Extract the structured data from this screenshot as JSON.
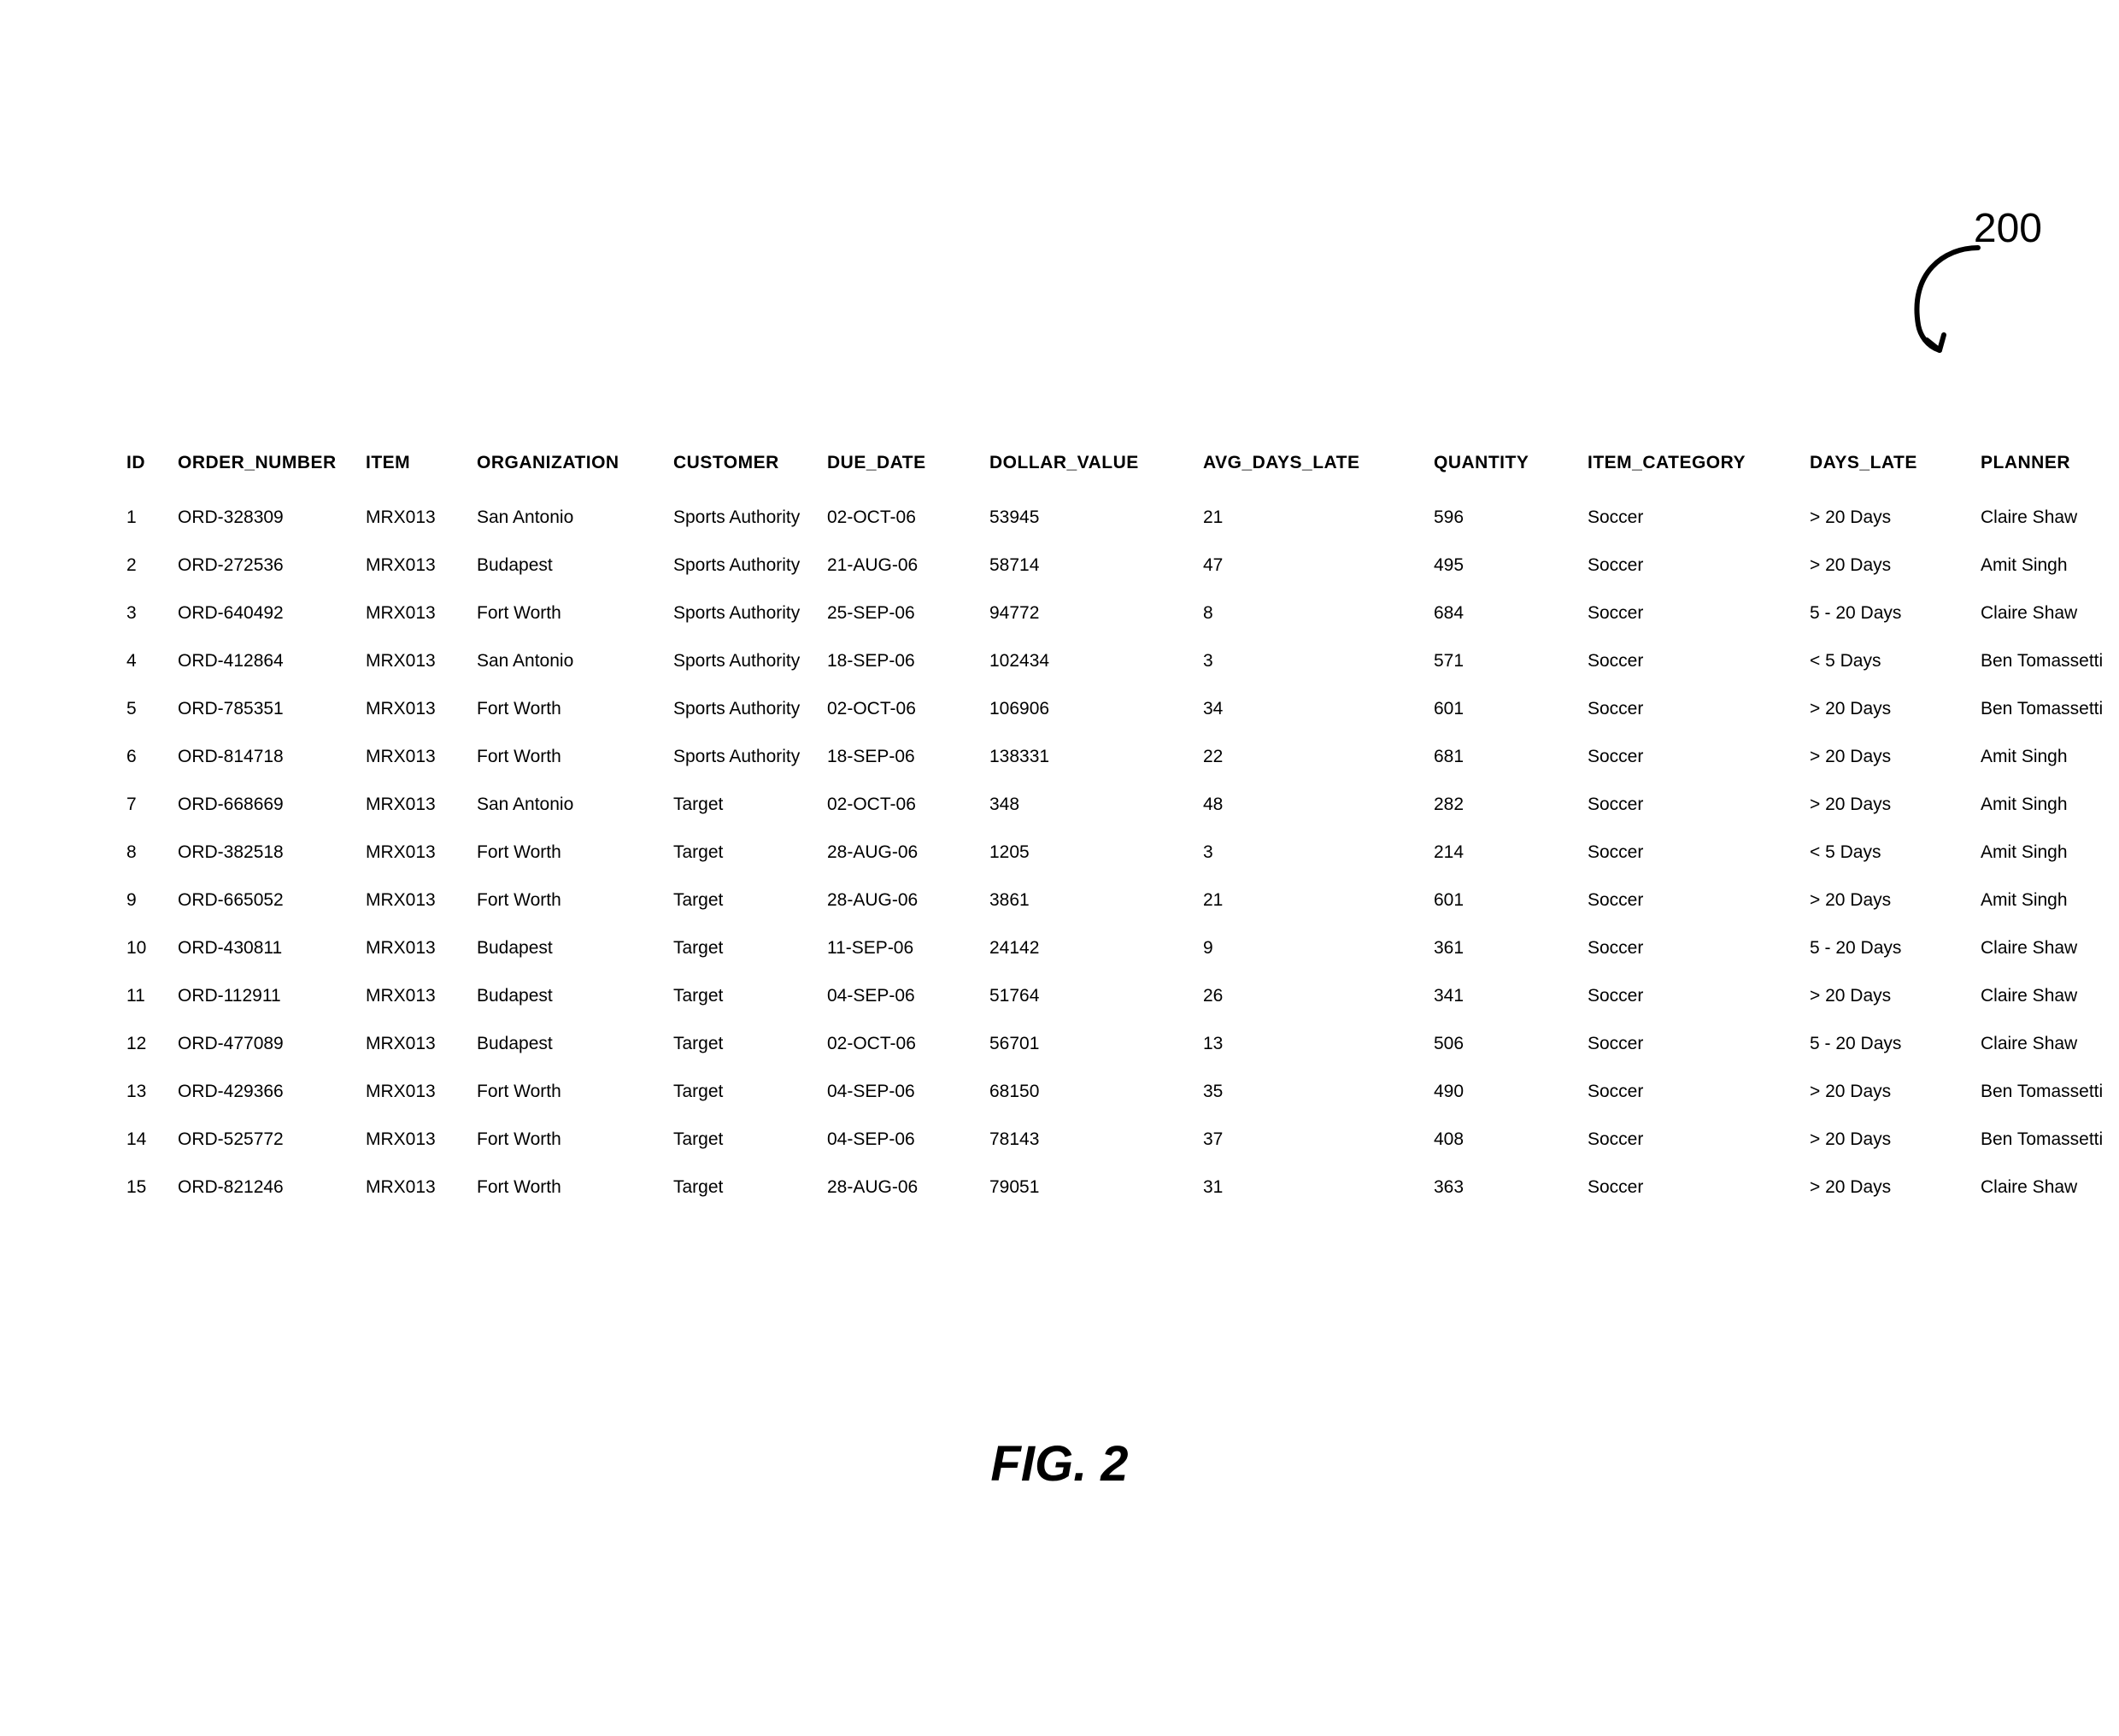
{
  "callout": {
    "number": "200"
  },
  "caption": "FIG. 2",
  "table": {
    "headers": {
      "id": "ID",
      "order_number": "ORDER_NUMBER",
      "item": "ITEM",
      "organization": "ORGANIZATION",
      "customer": "CUSTOMER",
      "due_date": "DUE_DATE",
      "dollar_value": "DOLLAR_VALUE",
      "avg_days_late": "AVG_DAYS_LATE",
      "quantity": "QUANTITY",
      "item_category": "ITEM_CATEGORY",
      "days_late": "DAYS_LATE",
      "planner": "PLANNER"
    },
    "rows": [
      {
        "id": "1",
        "order_number": "ORD-328309",
        "item": "MRX013",
        "organization": "San Antonio",
        "customer": "Sports Authority",
        "due_date": "02-OCT-06",
        "dollar_value": "53945",
        "avg_days_late": "21",
        "quantity": "596",
        "item_category": "Soccer",
        "days_late": "> 20 Days",
        "planner": "Claire Shaw"
      },
      {
        "id": "2",
        "order_number": "ORD-272536",
        "item": "MRX013",
        "organization": "Budapest",
        "customer": "Sports Authority",
        "due_date": "21-AUG-06",
        "dollar_value": "58714",
        "avg_days_late": "47",
        "quantity": "495",
        "item_category": "Soccer",
        "days_late": "> 20 Days",
        "planner": "Amit Singh"
      },
      {
        "id": "3",
        "order_number": "ORD-640492",
        "item": "MRX013",
        "organization": "Fort Worth",
        "customer": "Sports Authority",
        "due_date": "25-SEP-06",
        "dollar_value": "94772",
        "avg_days_late": "8",
        "quantity": "684",
        "item_category": "Soccer",
        "days_late": "5 - 20 Days",
        "planner": "Claire Shaw"
      },
      {
        "id": "4",
        "order_number": "ORD-412864",
        "item": "MRX013",
        "organization": "San Antonio",
        "customer": "Sports Authority",
        "due_date": "18-SEP-06",
        "dollar_value": "102434",
        "avg_days_late": "3",
        "quantity": "571",
        "item_category": "Soccer",
        "days_late": "< 5 Days",
        "planner": "Ben Tomassetti"
      },
      {
        "id": "5",
        "order_number": "ORD-785351",
        "item": "MRX013",
        "organization": "Fort Worth",
        "customer": "Sports Authority",
        "due_date": "02-OCT-06",
        "dollar_value": "106906",
        "avg_days_late": "34",
        "quantity": "601",
        "item_category": "Soccer",
        "days_late": "> 20 Days",
        "planner": "Ben Tomassetti"
      },
      {
        "id": "6",
        "order_number": "ORD-814718",
        "item": "MRX013",
        "organization": "Fort Worth",
        "customer": "Sports Authority",
        "due_date": "18-SEP-06",
        "dollar_value": "138331",
        "avg_days_late": "22",
        "quantity": "681",
        "item_category": "Soccer",
        "days_late": "> 20 Days",
        "planner": "Amit Singh"
      },
      {
        "id": "7",
        "order_number": "ORD-668669",
        "item": "MRX013",
        "organization": "San Antonio",
        "customer": "Target",
        "due_date": "02-OCT-06",
        "dollar_value": "348",
        "avg_days_late": "48",
        "quantity": "282",
        "item_category": "Soccer",
        "days_late": "> 20 Days",
        "planner": "Amit Singh"
      },
      {
        "id": "8",
        "order_number": "ORD-382518",
        "item": "MRX013",
        "organization": "Fort Worth",
        "customer": "Target",
        "due_date": "28-AUG-06",
        "dollar_value": "1205",
        "avg_days_late": "3",
        "quantity": "214",
        "item_category": "Soccer",
        "days_late": "< 5 Days",
        "planner": "Amit Singh"
      },
      {
        "id": "9",
        "order_number": "ORD-665052",
        "item": "MRX013",
        "organization": "Fort Worth",
        "customer": "Target",
        "due_date": "28-AUG-06",
        "dollar_value": "3861",
        "avg_days_late": "21",
        "quantity": "601",
        "item_category": "Soccer",
        "days_late": "> 20 Days",
        "planner": "Amit Singh"
      },
      {
        "id": "10",
        "order_number": "ORD-430811",
        "item": "MRX013",
        "organization": "Budapest",
        "customer": "Target",
        "due_date": "11-SEP-06",
        "dollar_value": "24142",
        "avg_days_late": "9",
        "quantity": "361",
        "item_category": "Soccer",
        "days_late": "5 - 20 Days",
        "planner": "Claire Shaw"
      },
      {
        "id": "11",
        "order_number": "ORD-112911",
        "item": "MRX013",
        "organization": "Budapest",
        "customer": "Target",
        "due_date": "04-SEP-06",
        "dollar_value": "51764",
        "avg_days_late": "26",
        "quantity": "341",
        "item_category": "Soccer",
        "days_late": "> 20 Days",
        "planner": "Claire Shaw"
      },
      {
        "id": "12",
        "order_number": "ORD-477089",
        "item": "MRX013",
        "organization": "Budapest",
        "customer": "Target",
        "due_date": "02-OCT-06",
        "dollar_value": "56701",
        "avg_days_late": "13",
        "quantity": "506",
        "item_category": "Soccer",
        "days_late": "5 - 20 Days",
        "planner": "Claire Shaw"
      },
      {
        "id": "13",
        "order_number": "ORD-429366",
        "item": "MRX013",
        "organization": "Fort Worth",
        "customer": "Target",
        "due_date": "04-SEP-06",
        "dollar_value": "68150",
        "avg_days_late": "35",
        "quantity": "490",
        "item_category": "Soccer",
        "days_late": "> 20 Days",
        "planner": "Ben Tomassetti"
      },
      {
        "id": "14",
        "order_number": "ORD-525772",
        "item": "MRX013",
        "organization": "Fort Worth",
        "customer": "Target",
        "due_date": "04-SEP-06",
        "dollar_value": "78143",
        "avg_days_late": "37",
        "quantity": "408",
        "item_category": "Soccer",
        "days_late": "> 20 Days",
        "planner": "Ben Tomassetti"
      },
      {
        "id": "15",
        "order_number": "ORD-821246",
        "item": "MRX013",
        "organization": "Fort Worth",
        "customer": "Target",
        "due_date": "28-AUG-06",
        "dollar_value": "79051",
        "avg_days_late": "31",
        "quantity": "363",
        "item_category": "Soccer",
        "days_late": "> 20 Days",
        "planner": "Claire Shaw"
      }
    ]
  }
}
